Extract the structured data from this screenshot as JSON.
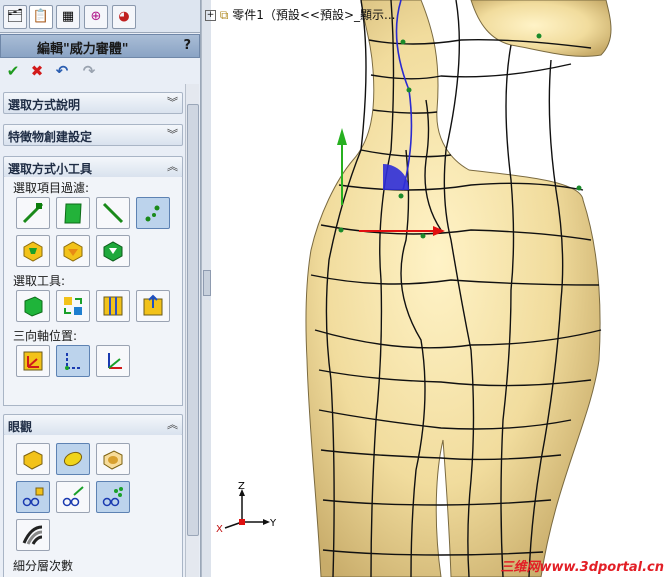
{
  "panel": {
    "title": "編輯\"威力審體\"",
    "help": "?",
    "sections": {
      "selection_help": "選取方式說明",
      "feature_settings": "特徵物創建設定",
      "selection_tools": "選取方式小工具",
      "display": "眼觀"
    },
    "labels": {
      "filter": "選取項目過濾:",
      "tools": "選取工具:",
      "triad": "三向軸位置:",
      "subdiv": "細分層次數"
    }
  },
  "tree": {
    "text": "零件1（預設<<預設>_顯示..."
  },
  "triad": {
    "z": "Z",
    "x": "X",
    "y": "Y"
  },
  "watermark": "三维网www.3dportal.cn",
  "colors": {
    "model_fill": "#f2dca2",
    "mesh_line": "#111111",
    "accent_blue": "#2a2ad0",
    "green_arrow": "#27b020",
    "red_arrow": "#e01010"
  },
  "icons": [
    "select-icon",
    "edit-icon",
    "tree-icon",
    "target-icon",
    "color-wheel-icon"
  ]
}
